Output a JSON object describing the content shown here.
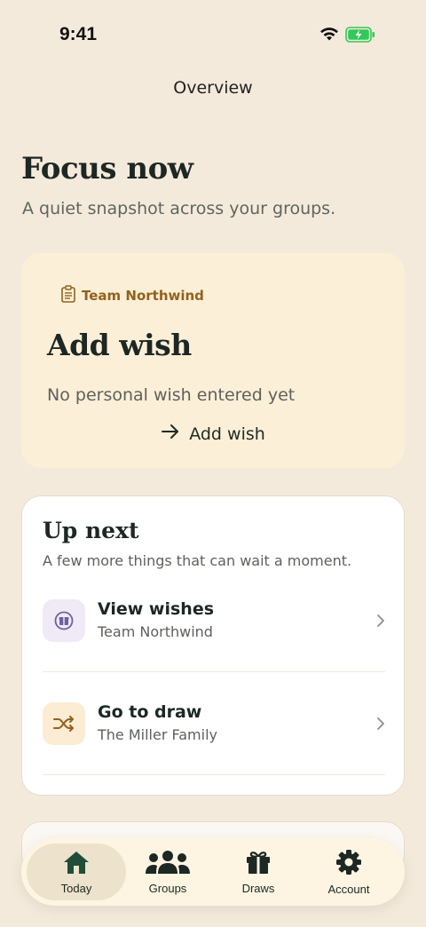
{
  "status": {
    "time": "9:41"
  },
  "nav": {
    "title": "Overview"
  },
  "hero": {
    "title": "Focus now",
    "subtitle": "A quiet snapshot across your groups."
  },
  "focus": {
    "group": "Team Northwind",
    "title": "Add wish",
    "description": "No personal wish entered yet",
    "action": "Add wish"
  },
  "next": {
    "title": "Up next",
    "subtitle": "A few more things that can wait a moment.",
    "items": [
      {
        "title": "View wishes",
        "subtitle": "Team Northwind",
        "icon": "gift-circle-icon"
      },
      {
        "title": "Go to draw",
        "subtitle": "The Miller Family",
        "icon": "shuffle-icon"
      }
    ]
  },
  "tabs": [
    {
      "label": "Today",
      "icon": "home-icon",
      "active": true
    },
    {
      "label": "Groups",
      "icon": "people-icon",
      "active": false
    },
    {
      "label": "Draws",
      "icon": "gift-icon",
      "active": false
    },
    {
      "label": "Account",
      "icon": "gear-icon",
      "active": false
    }
  ],
  "colors": {
    "background": "#f4eadb",
    "accent": "#93621c",
    "primary_green": "#1f4d3a",
    "card_highlight": "#fcefd8"
  }
}
